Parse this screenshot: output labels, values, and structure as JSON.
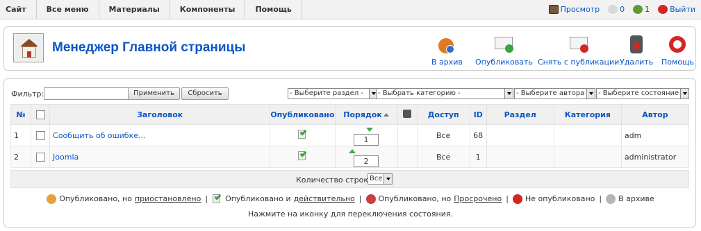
{
  "topmenu": {
    "items": [
      "Сайт",
      "Все меню",
      "Материалы",
      "Компоненты",
      "Помощь"
    ]
  },
  "status": {
    "preview": "Просмотр",
    "messages": "0",
    "users": "1",
    "logout": "Выйти"
  },
  "header": {
    "title": "Менеджер Главной страницы"
  },
  "toolbar": {
    "archive": "В архив",
    "publish": "Опубликовать",
    "unpublish": "Снять с публикации",
    "delete": "Удалить",
    "help": "Помощь"
  },
  "filter": {
    "label": "Фильтр:",
    "value": "",
    "apply": "Применить",
    "reset": "Сбросить",
    "section": "- Выберите раздел -",
    "category": "- Выбрать категорию -",
    "author": "- Выберите автора -",
    "state": "- Выберите состояние -"
  },
  "table": {
    "headers": {
      "num": "№",
      "title": "Заголовок",
      "published": "Опубликовано",
      "order": "Порядок",
      "access": "Доступ",
      "id": "ID",
      "section": "Раздел",
      "category": "Категория",
      "author": "Автор"
    },
    "rows": [
      {
        "num": "1",
        "title": "Сообщить об ошибке...",
        "order": "1",
        "access": "Все",
        "id": "68",
        "section": "",
        "category": "",
        "author": "adm"
      },
      {
        "num": "2",
        "title": "Joomla",
        "order": "2",
        "access": "Все",
        "id": "1",
        "section": "",
        "category": "",
        "author": "administrator"
      }
    ],
    "rows_label": "Количество строк:",
    "rows_value": "Все"
  },
  "legend": {
    "pending_a": "Опубликовано, но",
    "pending_b": "приостановлено",
    "current_a": "Опубликовано и",
    "current_b": "действительно",
    "expired_a": "Опубликовано, но",
    "expired_b": "Просрочено",
    "unpublished": "Не опубликовано",
    "archived": "В архиве",
    "sep": "|"
  },
  "hint": "Нажмите на иконку для переключения состояния.",
  "colors": {
    "link": "#0b55c4",
    "header_bg": "#f0f0f0",
    "published_check": "#3aa33a",
    "unpublished": "#d42525"
  }
}
